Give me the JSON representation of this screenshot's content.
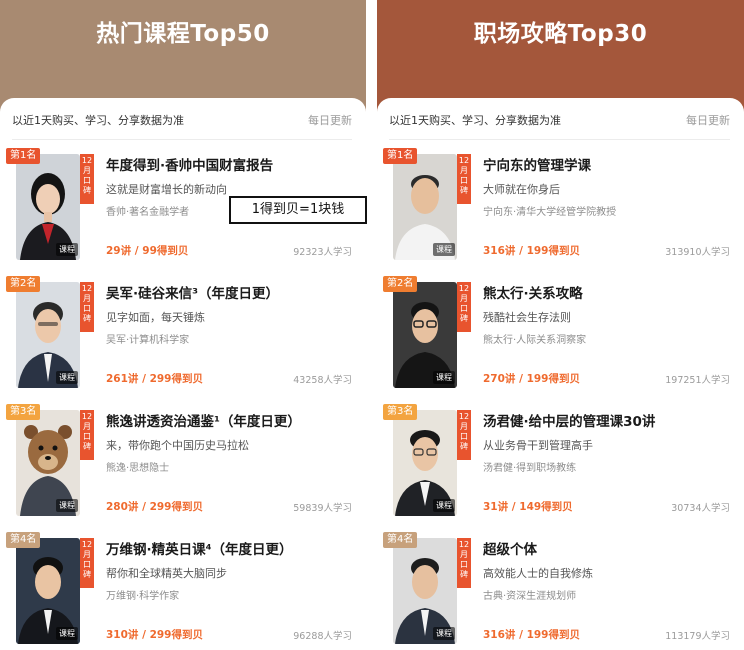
{
  "colors": {
    "left_bg": "#a88a71",
    "right_bg": "#a4573b",
    "accent": "#ef6a2e",
    "rank1": "#e8542e",
    "rank4": "#c7a17c"
  },
  "left": {
    "title": "热门课程Top50",
    "note": "以近1天购买、学习、分享数据为准",
    "update": "每日更新",
    "items": [
      {
        "rank": "第1名",
        "month_tag": "12月口碑",
        "badge": "课程",
        "title": "年度得到·香帅中国财富报告",
        "subtitle": "这就是财富增长的新动向",
        "author": "香帅·著名金融学者",
        "price": "29讲 / 99得到贝",
        "learners": "92323人学习"
      },
      {
        "rank": "第2名",
        "month_tag": "12月口碑",
        "badge": "课程",
        "title": "吴军·硅谷来信³（年度日更）",
        "subtitle": "见字如面，每天锤炼",
        "author": "吴军·计算机科学家",
        "price": "261讲 / 299得到贝",
        "learners": "43258人学习"
      },
      {
        "rank": "第3名",
        "month_tag": "12月口碑",
        "badge": "课程",
        "title": "熊逸讲透资治通鉴¹（年度日更）",
        "subtitle": "来，带你跑个中国历史马拉松",
        "author": "熊逸·思想隐士",
        "price": "280讲 / 299得到贝",
        "learners": "59839人学习"
      },
      {
        "rank": "第4名",
        "month_tag": "12月口碑",
        "badge": "课程",
        "title": "万维钢·精英日课⁴（年度日更）",
        "subtitle": "帮你和全球精英大脑同步",
        "author": "万维钢·科学作家",
        "price": "310讲 / 299得到贝",
        "learners": "96288人学习"
      }
    ]
  },
  "right": {
    "title": "职场攻略Top30",
    "note": "以近1天购买、学习、分享数据为准",
    "update": "每日更新",
    "items": [
      {
        "rank": "第1名",
        "month_tag": "12月口碑",
        "badge": "课程",
        "title": "宁向东的管理学课",
        "subtitle": "大师就在你身后",
        "author": "宁向东·清华大学经管学院教授",
        "price": "316讲 / 199得到贝",
        "learners": "313910人学习"
      },
      {
        "rank": "第2名",
        "month_tag": "12月口碑",
        "badge": "课程",
        "title": "熊太行·关系攻略",
        "subtitle": "残酷社会生存法则",
        "author": "熊太行·人际关系洞察家",
        "price": "270讲 / 199得到贝",
        "learners": "197251人学习"
      },
      {
        "rank": "第3名",
        "month_tag": "12月口碑",
        "badge": "课程",
        "title": "汤君健·给中层的管理课30讲",
        "subtitle": "从业务骨干到管理高手",
        "author": "汤君健·得到职场教练",
        "price": "31讲 / 149得到贝",
        "learners": "30734人学习"
      },
      {
        "rank": "第4名",
        "month_tag": "12月口碑",
        "badge": "课程",
        "title": "超级个体",
        "subtitle": "高效能人士的自我修炼",
        "author": "古典·资深生涯规划师",
        "price": "316讲 / 199得到贝",
        "learners": "113179人学习"
      }
    ]
  },
  "annotation": "1得到贝=1块钱"
}
